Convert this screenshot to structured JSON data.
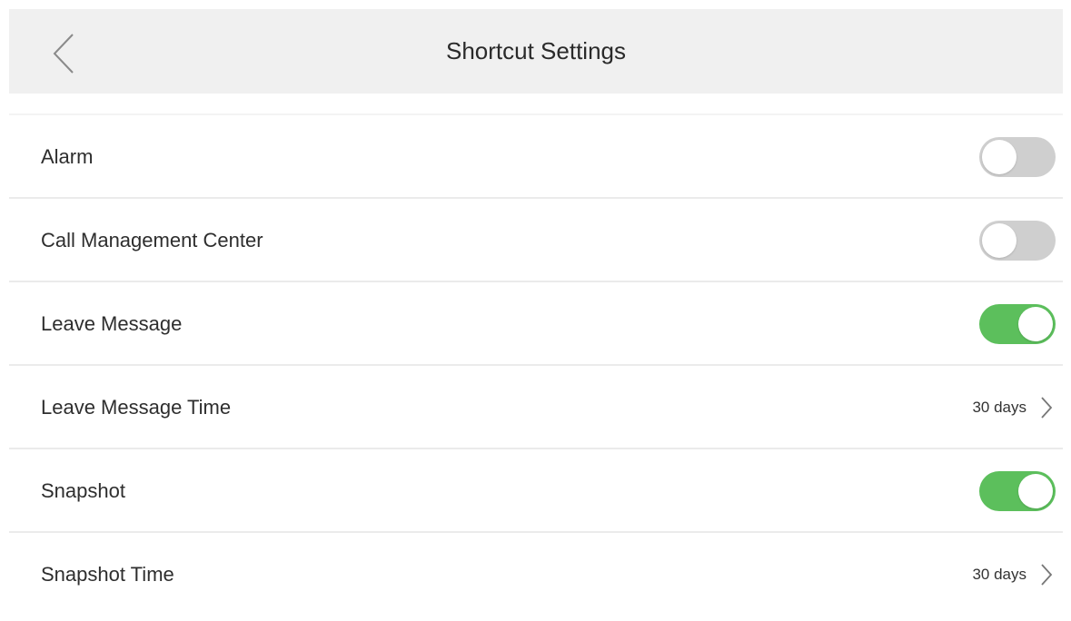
{
  "header": {
    "title": "Shortcut Settings",
    "back_icon": "chevron-left-icon"
  },
  "colors": {
    "header_bg": "#f0f0f0",
    "toggle_on": "#5cbf5c",
    "toggle_off": "#cfcfcf",
    "divider": "#ebebeb"
  },
  "settings": [
    {
      "label": "Alarm",
      "type": "toggle",
      "state": "off"
    },
    {
      "label": "Call Management Center",
      "type": "toggle",
      "state": "off"
    },
    {
      "label": "Leave Message",
      "type": "toggle",
      "state": "on"
    },
    {
      "label": "Leave Message Time",
      "type": "select",
      "value": "30 days",
      "icon": "chevron-right-icon"
    },
    {
      "label": "Snapshot",
      "type": "toggle",
      "state": "on"
    },
    {
      "label": "Snapshot Time",
      "type": "select",
      "value": "30 days",
      "icon": "chevron-right-icon"
    }
  ]
}
